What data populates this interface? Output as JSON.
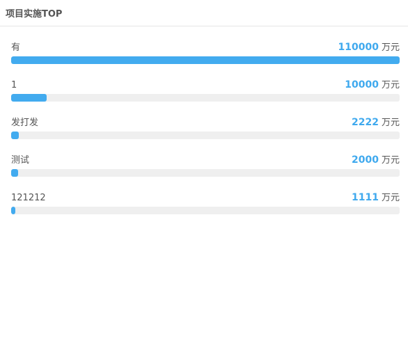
{
  "panel": {
    "title": "项目实施TOP"
  },
  "colors": {
    "bar_fill": "#42abef",
    "bar_track": "#efefef",
    "value_text": "#3fa9ee",
    "label_text": "#555555"
  },
  "items": [
    {
      "name": "有",
      "value": "110000",
      "unit": "万元",
      "share": 1.0
    },
    {
      "name": "1",
      "value": "10000",
      "unit": "万元",
      "share": 0.0909
    },
    {
      "name": "发打发",
      "value": "2222",
      "unit": "万元",
      "share": 0.0202
    },
    {
      "name": "测试",
      "value": "2000",
      "unit": "万元",
      "share": 0.0182
    },
    {
      "name": "121212",
      "value": "1111",
      "unit": "万元",
      "share": 0.0101
    }
  ]
}
